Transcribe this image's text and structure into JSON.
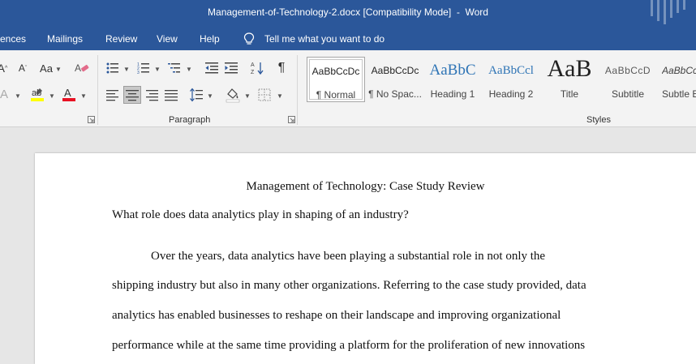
{
  "window": {
    "title": "Management-of-Technology-2.docx [Compatibility Mode]  -  Word"
  },
  "menu": {
    "tabs": [
      "rences",
      "Mailings",
      "Review",
      "View",
      "Help"
    ],
    "tell_me": "Tell me what you want to do"
  },
  "ribbon": {
    "font_group": {
      "icons": [
        "increase-font-size-icon",
        "decrease-font-size-icon",
        "change-case-icon",
        "clear-formatting-icon",
        "text-effects-icon",
        "highlight-color-icon",
        "font-color-icon"
      ],
      "change_case_label": "Aa",
      "highlight_color": "#ffff00",
      "font_color": "#e81123"
    },
    "paragraph_group": {
      "label": "Paragraph",
      "icons": [
        "bullets-icon",
        "numbering-icon",
        "multilevel-list-icon",
        "decrease-indent-icon",
        "increase-indent-icon",
        "sort-icon",
        "show-hide-icon",
        "align-left-icon",
        "align-center-icon",
        "align-right-icon",
        "justify-icon",
        "line-spacing-icon",
        "shading-icon",
        "borders-icon"
      ],
      "selected_alignment": "align-center",
      "show_hide_glyph": "¶"
    },
    "styles_group": {
      "label": "Styles",
      "items": [
        {
          "preview": "AaBbCcDc",
          "name": "¶ Normal",
          "selected": true
        },
        {
          "preview": "AaBbCcDc",
          "name": "¶ No Spac..."
        },
        {
          "preview": "AaBbC",
          "name": "Heading 1",
          "color": "#2e74b5"
        },
        {
          "preview": "AaBbCcl",
          "name": "Heading 2",
          "color": "#2e74b5"
        },
        {
          "preview": "AaB",
          "name": "Title"
        },
        {
          "preview": "AaBbCcD",
          "name": "Subtitle",
          "color": "#595959"
        },
        {
          "preview": "AaBbCcD",
          "name": "Subtle E"
        }
      ]
    }
  },
  "document": {
    "title": "Management of Technology: Case Study Review",
    "question": "What role does data analytics play in shaping of an industry?",
    "paragraph_lines": [
      "Over the years, data analytics have been playing a substantial role in not only the",
      "shipping industry but also in many other organizations. Referring to the case study provided, data",
      "analytics has enabled businesses to reshape on their landscape and improving organizational",
      "performance while at the same time providing a platform for the proliferation of new innovations"
    ]
  },
  "colors": {
    "title_bar": "#2b579a",
    "ribbon_bg": "#f3f3f3",
    "doc_bg": "#e6e6e6"
  }
}
